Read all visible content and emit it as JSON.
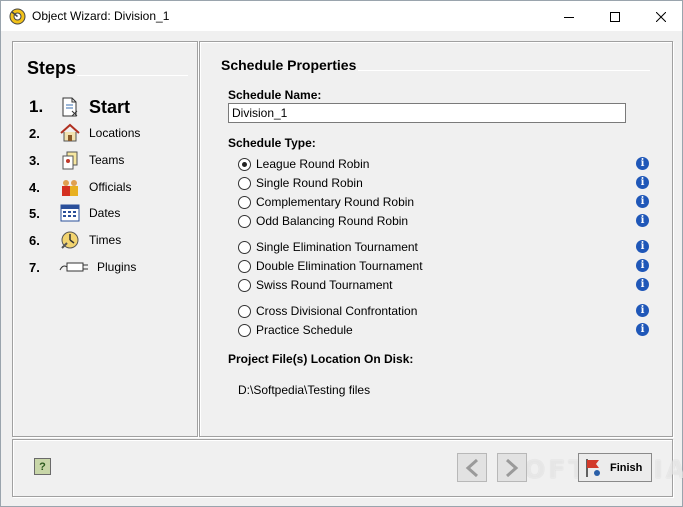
{
  "window": {
    "title": "Object Wizard: Division_1"
  },
  "steps": {
    "title": "Steps",
    "items": [
      {
        "num": "1.",
        "label": "Start",
        "icon": "document-icon",
        "active": true
      },
      {
        "num": "2.",
        "label": "Locations",
        "icon": "house-icon"
      },
      {
        "num": "3.",
        "label": "Teams",
        "icon": "cards-icon"
      },
      {
        "num": "4.",
        "label": "Officials",
        "icon": "people-icon"
      },
      {
        "num": "5.",
        "label": "Dates",
        "icon": "calendar-icon"
      },
      {
        "num": "6.",
        "label": "Times",
        "icon": "clock-icon"
      },
      {
        "num": "7.",
        "label": "Plugins",
        "icon": "plug-icon"
      }
    ]
  },
  "props": {
    "title": "Schedule Properties",
    "name_label": "Schedule Name:",
    "name_value": "Division_1",
    "type_label": "Schedule Type:",
    "types": [
      {
        "label": "League Round Robin",
        "checked": true
      },
      {
        "label": "Single Round Robin"
      },
      {
        "label": "Complementary Round Robin"
      },
      {
        "label": "Odd Balancing Round Robin"
      },
      {
        "label": "Single Elimination Tournament"
      },
      {
        "label": "Double Elimination Tournament"
      },
      {
        "label": "Swiss Round Tournament"
      },
      {
        "label": "Cross Divisional Confrontation"
      },
      {
        "label": "Practice Schedule"
      }
    ],
    "location_label": "Project File(s) Location On Disk:",
    "location_value": "D:\\Softpedia\\Testing files"
  },
  "bottom": {
    "finish_label": "Finish",
    "watermark": "SOFTPEDIA"
  }
}
